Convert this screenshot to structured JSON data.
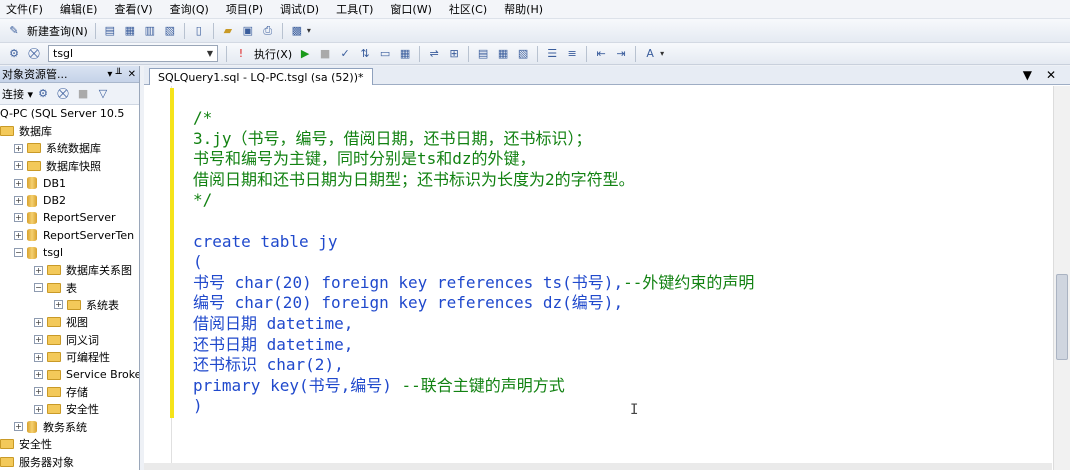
{
  "menu": [
    "文件(F)",
    "编辑(E)",
    "查看(V)",
    "查询(Q)",
    "项目(P)",
    "调试(D)",
    "工具(T)",
    "窗口(W)",
    "社区(C)",
    "帮助(H)"
  ],
  "toolbar": {
    "new_query": "新建查询(N)",
    "database": "tsgl",
    "execute": "执行(X)"
  },
  "object_explorer": {
    "title": "对象资源管...",
    "pin": "▾ ╨",
    "close": "✕",
    "connect": "连接 ▾",
    "tree": [
      {
        "label": "Q-PC (SQL Server 10.5",
        "indent": 0,
        "expander": "",
        "icon": "server"
      },
      {
        "label": "数据库",
        "indent": 0,
        "expander": "",
        "icon": "folder"
      },
      {
        "label": "系统数据库",
        "indent": 1,
        "expander": "+",
        "icon": "folder"
      },
      {
        "label": "数据库快照",
        "indent": 1,
        "expander": "+",
        "icon": "folder"
      },
      {
        "label": "DB1",
        "indent": 1,
        "expander": "+",
        "icon": "db"
      },
      {
        "label": "DB2",
        "indent": 1,
        "expander": "+",
        "icon": "db"
      },
      {
        "label": "ReportServer",
        "indent": 1,
        "expander": "+",
        "icon": "db"
      },
      {
        "label": "ReportServerTen",
        "indent": 1,
        "expander": "+",
        "icon": "db"
      },
      {
        "label": "tsgl",
        "indent": 1,
        "expander": "−",
        "icon": "db"
      },
      {
        "label": "数据库关系图",
        "indent": 2,
        "expander": "+",
        "icon": "folder"
      },
      {
        "label": "表",
        "indent": 2,
        "expander": "−",
        "icon": "folder"
      },
      {
        "label": "系统表",
        "indent": 3,
        "expander": "+",
        "icon": "folder"
      },
      {
        "label": "视图",
        "indent": 2,
        "expander": "+",
        "icon": "folder"
      },
      {
        "label": "同义词",
        "indent": 2,
        "expander": "+",
        "icon": "folder"
      },
      {
        "label": "可编程性",
        "indent": 2,
        "expander": "+",
        "icon": "folder"
      },
      {
        "label": "Service Broke",
        "indent": 2,
        "expander": "+",
        "icon": "folder"
      },
      {
        "label": "存储",
        "indent": 2,
        "expander": "+",
        "icon": "folder"
      },
      {
        "label": "安全性",
        "indent": 2,
        "expander": "+",
        "icon": "folder"
      },
      {
        "label": "教务系统",
        "indent": 1,
        "expander": "+",
        "icon": "db"
      },
      {
        "label": "安全性",
        "indent": 0,
        "expander": "",
        "icon": "folder"
      },
      {
        "label": "服务器对象",
        "indent": 0,
        "expander": "",
        "icon": "folder"
      }
    ]
  },
  "editor": {
    "tab_title": "SQLQuery1.sql - LQ-PC.tsgl (sa (52))*",
    "tab_dropdown": "▼",
    "tab_close": "✕",
    "lines": [
      [
        {
          "t": "/*",
          "c": "cm"
        }
      ],
      [
        {
          "t": "3.jy（书号，编号，借阅日期，还书日期，还书标识）；",
          "c": "cm"
        }
      ],
      [
        {
          "t": "书号和编号为主键，同时分别是ts和dz的外键，",
          "c": "cm"
        }
      ],
      [
        {
          "t": "借阅日期和还书日期为日期型；还书标识为长度为2的字符型。",
          "c": "cm"
        }
      ],
      [
        {
          "t": "*/",
          "c": "cm"
        }
      ],
      [
        {
          "t": "",
          "c": "tx"
        }
      ],
      [
        {
          "t": "create table jy",
          "c": "kw"
        }
      ],
      [
        {
          "t": "(",
          "c": "tx"
        }
      ],
      [
        {
          "t": "书号 ",
          "c": "tx"
        },
        {
          "t": "char",
          "c": "kw"
        },
        {
          "t": "(20) ",
          "c": "tx"
        },
        {
          "t": "foreign key references ",
          "c": "kw"
        },
        {
          "t": "ts(书号),",
          "c": "tx"
        },
        {
          "t": "--外键约束的声明",
          "c": "cm"
        }
      ],
      [
        {
          "t": "编号 ",
          "c": "tx"
        },
        {
          "t": "char",
          "c": "kw"
        },
        {
          "t": "(20) ",
          "c": "tx"
        },
        {
          "t": "foreign key references ",
          "c": "kw"
        },
        {
          "t": "dz(编号),",
          "c": "tx"
        }
      ],
      [
        {
          "t": "借阅日期 ",
          "c": "tx"
        },
        {
          "t": "datetime",
          "c": "kw"
        },
        {
          "t": ",",
          "c": "tx"
        }
      ],
      [
        {
          "t": "还书日期 ",
          "c": "tx"
        },
        {
          "t": "datetime",
          "c": "kw"
        },
        {
          "t": ",",
          "c": "tx"
        }
      ],
      [
        {
          "t": "还书标识 ",
          "c": "tx"
        },
        {
          "t": "char",
          "c": "kw"
        },
        {
          "t": "(2),",
          "c": "tx"
        }
      ],
      [
        {
          "t": "primary key",
          "c": "kw"
        },
        {
          "t": "(书号,编号) ",
          "c": "tx"
        },
        {
          "t": "--联合主键的声明方式",
          "c": "cm"
        }
      ],
      [
        {
          "t": ")",
          "c": "tx"
        }
      ]
    ]
  },
  "colors": {
    "comment": "#128212",
    "keyword": "#2049cc",
    "highlight_bar": "#f5e31a"
  }
}
